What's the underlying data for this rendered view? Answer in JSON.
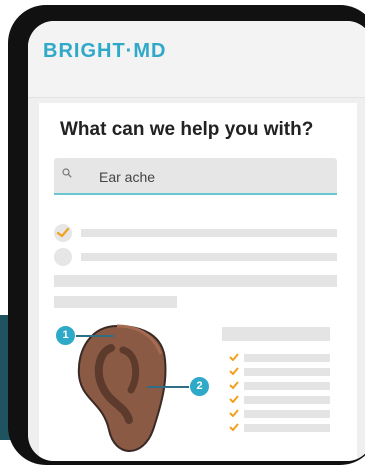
{
  "brand": {
    "logo_text": "BRIGHT·MD"
  },
  "main": {
    "question": "What can we help you with?",
    "search": {
      "value": "Ear ache",
      "icon": "search-icon"
    },
    "markers": [
      {
        "label": "1"
      },
      {
        "label": "2"
      }
    ]
  },
  "colors": {
    "brand": "#2fa9c8",
    "check": "#f0a11d",
    "ear": "#8a5a45",
    "teal_bg": "#1f5360"
  }
}
